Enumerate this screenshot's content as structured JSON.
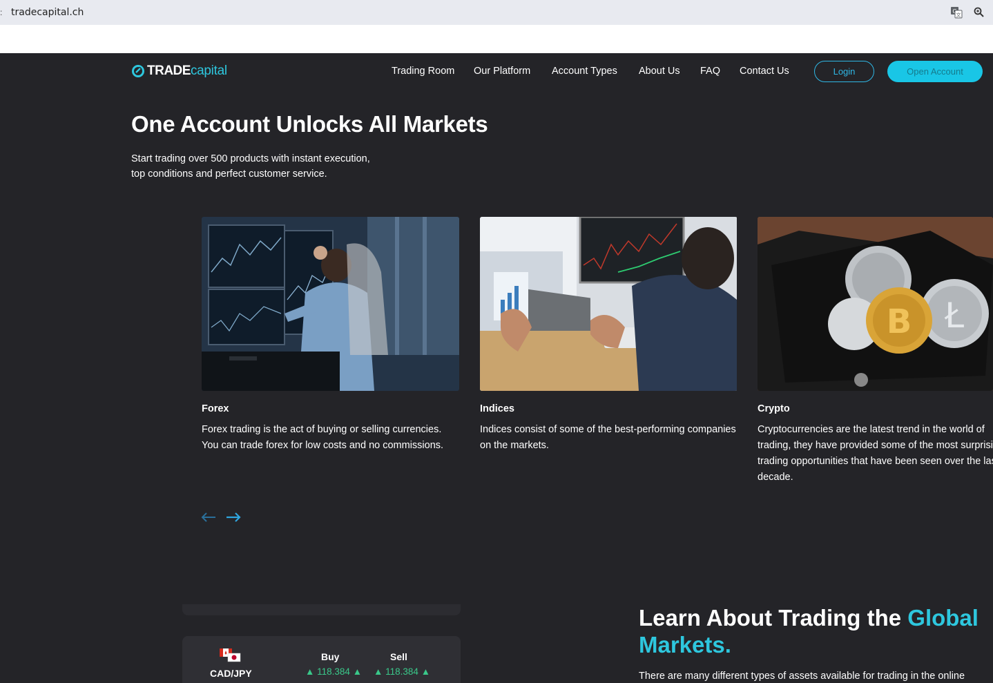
{
  "browser": {
    "url": "tradecapital.ch",
    "icons": [
      "translate-icon",
      "zoom-icon"
    ]
  },
  "brand": {
    "logo_bold": "TRADE",
    "logo_light": "capital",
    "accent_color": "#2ec7de",
    "background": "#242428"
  },
  "nav": {
    "items": [
      "Trading Room",
      "Our Platform",
      "Account Types",
      "About Us",
      "FAQ",
      "Contact Us"
    ],
    "login_label": "Login",
    "open_account_label": "Open Account"
  },
  "hero": {
    "title": "One Account Unlocks All Markets",
    "subtitle_line1": "Start trading over 500 products with instant execution,",
    "subtitle_line2": "top conditions and perfect customer service."
  },
  "cards": [
    {
      "title": "Forex",
      "desc": "Forex trading is the act of buying or selling currencies. You can trade forex for low costs and no commissions."
    },
    {
      "title": "Indices",
      "desc": "Indices consist of some of the best-performing companies on the markets."
    },
    {
      "title": "Crypto",
      "desc": "Cryptocurrencies are the latest trend in the world of trading, they have provided some of the most surprising trading opportunities that have been seen over the last decade."
    }
  ],
  "ticker": {
    "pair": "CAD/JPY",
    "buy_label": "Buy",
    "sell_label": "Sell",
    "buy_value": "118.384",
    "sell_value": "118.384",
    "up_color": "#3ac88a"
  },
  "learn": {
    "title_start": "Learn About Trading the ",
    "title_accent1": "Global",
    "title_accent2": "Markets.",
    "text": "There are many different types of assets available for trading in the online"
  }
}
